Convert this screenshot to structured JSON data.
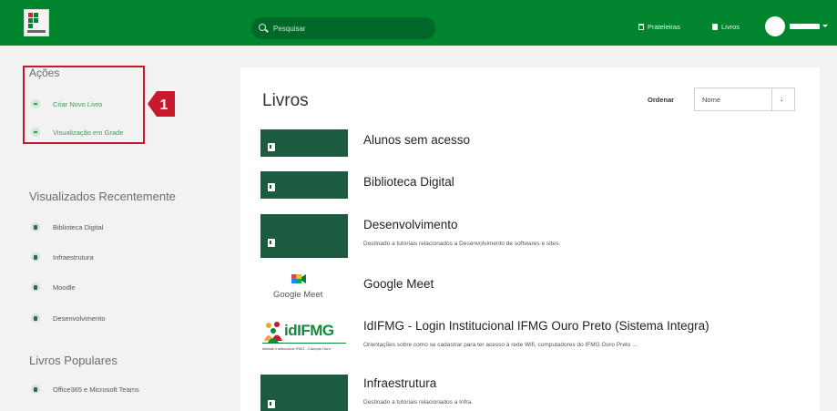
{
  "header": {
    "search_placeholder": "Pesquisar",
    "nav_shelves": "Prateleiras",
    "nav_books": "Livros"
  },
  "sidebar": {
    "actions_title": "Ações",
    "actions": [
      {
        "label": "Criar Novo Livro",
        "icon": "plus-icon"
      },
      {
        "label": "Visualização em Grade",
        "icon": "grid-icon"
      }
    ],
    "recent_title": "Visualizados Recentemente",
    "recent": [
      "Biblioteca Digital",
      "Infraestrutura",
      "Moodle",
      "Desenvolvimento"
    ],
    "popular_title": "Livros Populares",
    "popular": [
      "Office365 e Microsoft Teams"
    ]
  },
  "annotation": {
    "number": "1",
    "color": "#c8182e"
  },
  "main": {
    "title": "Livros",
    "sort_label": "Ordenar",
    "sort_value": "Nome",
    "sort_direction_icon": "sort-arrow-icon",
    "books": [
      {
        "title": "Alunos sem acesso",
        "description": ""
      },
      {
        "title": "Biblioteca Digital",
        "description": ""
      },
      {
        "title": "Desenvolvimento",
        "description": "Destinado a tutoriais relacionados a Desenvolvimento de softwares e sites."
      },
      {
        "title": "Google Meet",
        "description": "",
        "logo_text": "Google Meet"
      },
      {
        "title": "IdIFMG - Login Institucional IFMG Ouro Preto (Sistema Integra)",
        "description": "Orientações sobre como se cadastrar para ter acesso à rede Wifi, computadores do IFMG Ouro Preto ...",
        "logo_text": "idIFMG",
        "logo_subtext": "ntidade Institucional IFMG - Campus Ouro"
      },
      {
        "title": "Infraestrutura",
        "description": "Destinado a tutoriais relacionados a Infra."
      }
    ]
  },
  "colors": {
    "brand_green": "#00852f",
    "thumb_green": "#1c5b3f",
    "highlight_red": "#c8182e"
  }
}
